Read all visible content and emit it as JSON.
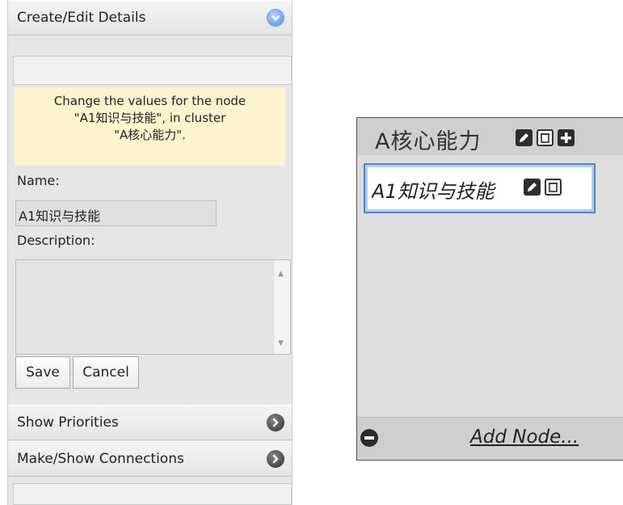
{
  "details_panel": {
    "header_label": "Create/Edit Details",
    "info_line1": "Change the values for the node",
    "info_line2": "\"A1知识与技能\", in cluster",
    "info_line3": "\"A核心能力\".",
    "name_label": "Name:",
    "name_value": "A1知识与技能",
    "description_label": "Description:",
    "description_value": "",
    "save_label": "Save",
    "cancel_label": "Cancel"
  },
  "sections": [
    {
      "label": "Show Priorities"
    },
    {
      "label": "Make/Show Connections"
    }
  ],
  "cluster": {
    "title": "A核心能力",
    "node_label": "A1知识与技能",
    "add_node_label": "Add Node..."
  },
  "colors": {
    "panel_bg": "#e6e6e6",
    "info_bg": "#fdf3cc",
    "expanded_icon": "#4a86e8",
    "node_border": "#4a86c5"
  },
  "icons": {
    "expanded": "chevron-down-circle-icon",
    "collapsed": "chevron-right-circle-icon",
    "edit": "pencil-icon",
    "delete": "trash-icon",
    "add": "plus-icon",
    "remove": "minus-circle-icon"
  }
}
